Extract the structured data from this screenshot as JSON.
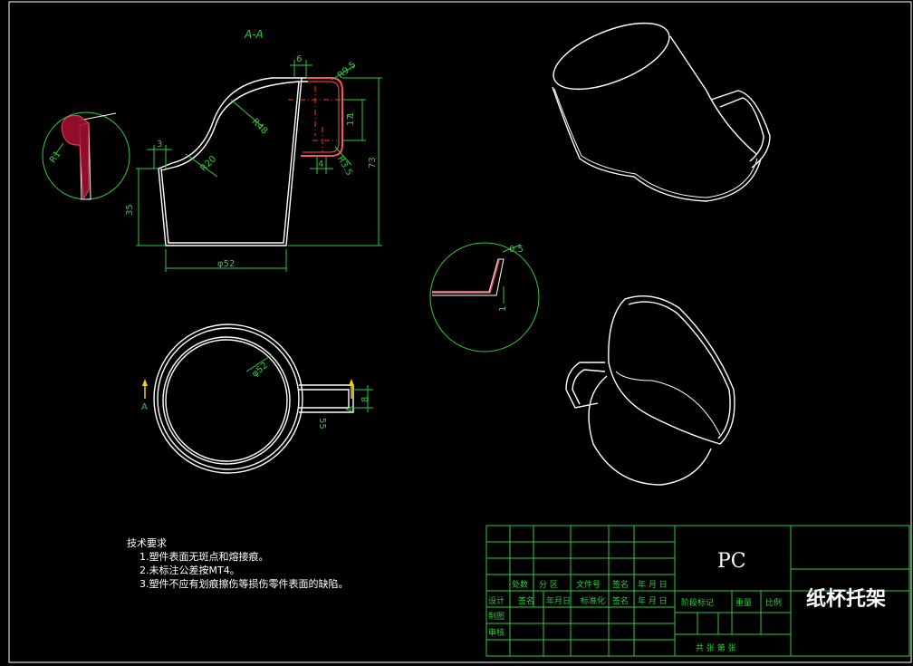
{
  "drawing": {
    "section_label": "A-A",
    "section_mark": "A",
    "material": "PC",
    "part_name": "纸杯托架"
  },
  "dimensions": {
    "top_width": "6",
    "r95": "R9.5",
    "r48": "R48",
    "r20": "R20",
    "d3": "3",
    "d35": "35",
    "d73": "73",
    "d17": "17",
    "d1": "1",
    "d4": "4",
    "r35": "R3.5",
    "phi52": "φ52",
    "r1": "R1",
    "d05": "0.5",
    "detail_1": "1",
    "phi52_top": "φ52",
    "d8": "8",
    "d55": "55"
  },
  "tech_requirements": {
    "title": "技术要求",
    "items": [
      "1.塑件表面无斑点和熔接痕。",
      "2.未标注公差按MT4。",
      "3.塑件不应有划痕擦伤等损伤零件表面的缺陷。"
    ]
  },
  "title_block": {
    "headers": [
      "处数",
      "分 区",
      "文件号",
      "签名",
      "年 月 日"
    ],
    "row_design": [
      "设计",
      "签名",
      "年月日",
      "标准化",
      "签名",
      "年 月 日"
    ],
    "stage_label": "阶段标记",
    "weight_label": "重量",
    "scale_label": "比例",
    "draw_label": "制图",
    "review_label": "审核",
    "sheet_text": "共    张 第    张"
  },
  "colors": {
    "line": "#ffffff",
    "dim": "#2ecc40",
    "center": "#ff3030",
    "background": "#000000"
  }
}
